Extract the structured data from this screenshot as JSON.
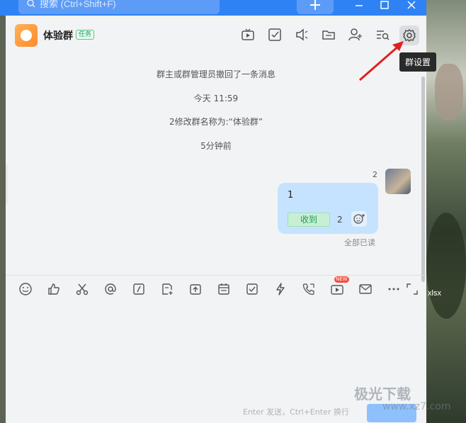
{
  "search": {
    "placeholder": "搜索 (Ctrl+Shift+F)"
  },
  "window": {
    "minimize": "—",
    "maximize": "☐",
    "close": "✕"
  },
  "header": {
    "group_name": "体验群",
    "tag": "任务",
    "tooltip": "群设置",
    "icons": [
      "tv-icon",
      "check-icon",
      "volume-icon",
      "folder-icon",
      "add-member-icon",
      "search-list-icon",
      "gear-icon"
    ]
  },
  "chat": {
    "system_messages": [
      "群主或群管理员撤回了一条消息",
      "今天 11:59",
      "2修改群名称为:“体验群”",
      "5分钟前"
    ],
    "message": {
      "read_count": "2",
      "text": "1",
      "received_label": "收到",
      "received_count": "2",
      "status": "全部已读"
    }
  },
  "toolbar": {
    "new_badge": "NEW",
    "tools": [
      "emoji-icon",
      "thumbs-up-icon",
      "scissors-icon",
      "at-icon",
      "slash-icon",
      "note-icon",
      "upload-icon",
      "calendar-icon",
      "task-check-icon",
      "lightning-icon",
      "phone-icon",
      "video-icon",
      "mail-icon",
      "more-icon",
      "expand-icon"
    ]
  },
  "input": {
    "hint": "Enter 发送，Ctrl+Enter 换行"
  },
  "desktop": {
    "file_label": "xlsx"
  },
  "watermark": {
    "brand": "极光下载",
    "site": "www.xz7.com"
  },
  "colors": {
    "accent": "#2f82f4",
    "bubble": "#c5e3ff",
    "received": "#1f9e56"
  }
}
